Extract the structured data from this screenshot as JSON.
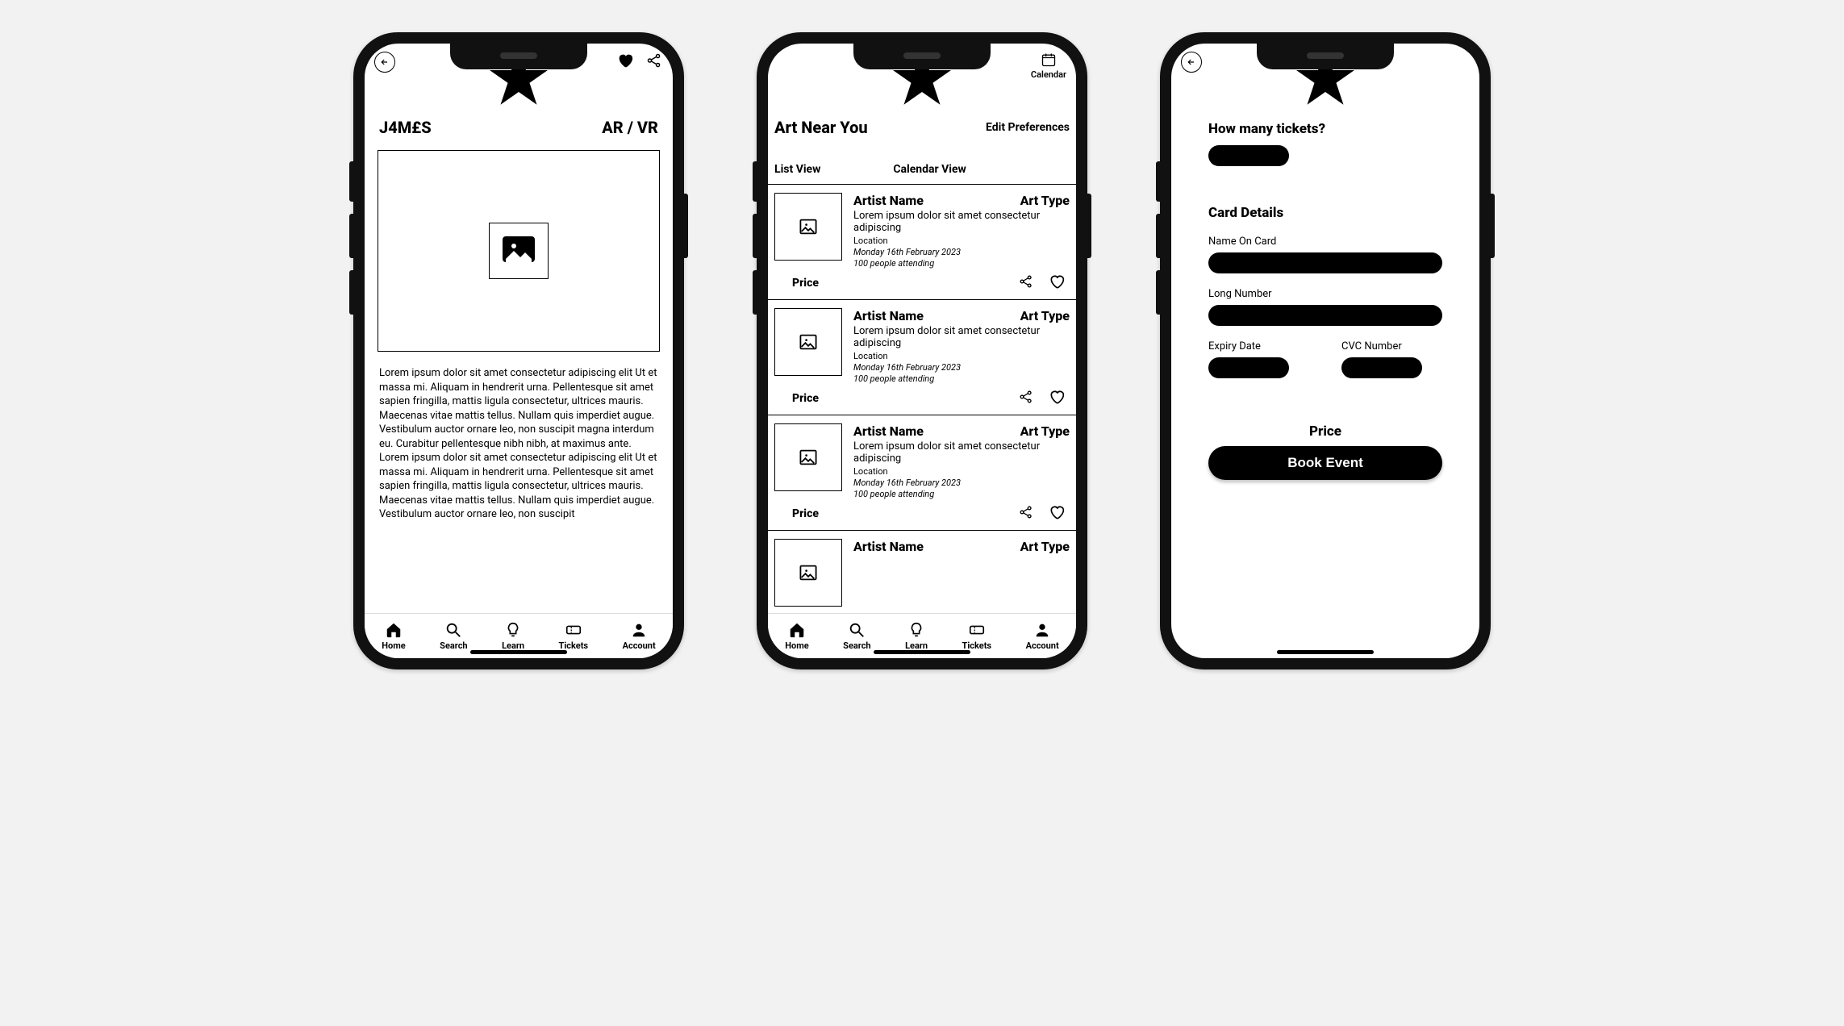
{
  "nav": {
    "home": "Home",
    "search": "Search",
    "learn": "Learn",
    "tickets": "Tickets",
    "account": "Account"
  },
  "screen1": {
    "artist": "J4M£S",
    "arvr": "AR / VR",
    "body": "Lorem ipsum dolor sit amet consectetur adipiscing elit Ut et massa mi. Aliquam in hendrerit urna. Pellentesque sit amet sapien fringilla, mattis ligula consectetur, ultrices mauris. Maecenas vitae mattis tellus. Nullam quis imperdiet augue. Vestibulum auctor ornare leo, non suscipit magna interdum eu. Curabitur pellentesque nibh nibh, at maximus ante. Lorem ipsum dolor sit amet consectetur adipiscing elit Ut et massa mi. Aliquam in hendrerit urna. Pellentesque sit amet sapien fringilla, mattis ligula consectetur, ultrices mauris. Maecenas vitae mattis tellus. Nullam quis imperdiet augue. Vestibulum auctor ornare leo, non suscipit"
  },
  "screen2": {
    "title": "Art Near You",
    "edit": "Edit Preferences",
    "calendar": "Calendar",
    "list_view": "List View",
    "calendar_view": "Calendar View",
    "price_label": "Price",
    "cards": [
      {
        "artist": "Artist Name",
        "type": "Art Type",
        "desc": "Lorem ipsum dolor sit amet consectetur adipiscing",
        "location": "Location",
        "date": "Monday 16th February 2023",
        "attending": "100 people attending"
      },
      {
        "artist": "Artist Name",
        "type": "Art Type",
        "desc": "Lorem ipsum dolor sit amet consectetur adipiscing",
        "location": "Location",
        "date": "Monday 16th February 2023",
        "attending": "100 people attending"
      },
      {
        "artist": "Artist Name",
        "type": "Art Type",
        "desc": "Lorem ipsum dolor sit amet consectetur adipiscing",
        "location": "Location",
        "date": "Monday 16th February 2023",
        "attending": "100 people attending"
      },
      {
        "artist": "Artist Name",
        "type": "Art Type",
        "desc": "",
        "location": "",
        "date": "",
        "attending": ""
      }
    ]
  },
  "screen3": {
    "q_tickets": "How many tickets?",
    "card_details": "Card Details",
    "name_on_card": "Name On Card",
    "long_number": "Long Number",
    "expiry": "Expiry Date",
    "cvc": "CVC Number",
    "price": "Price",
    "book": "Book Event"
  }
}
